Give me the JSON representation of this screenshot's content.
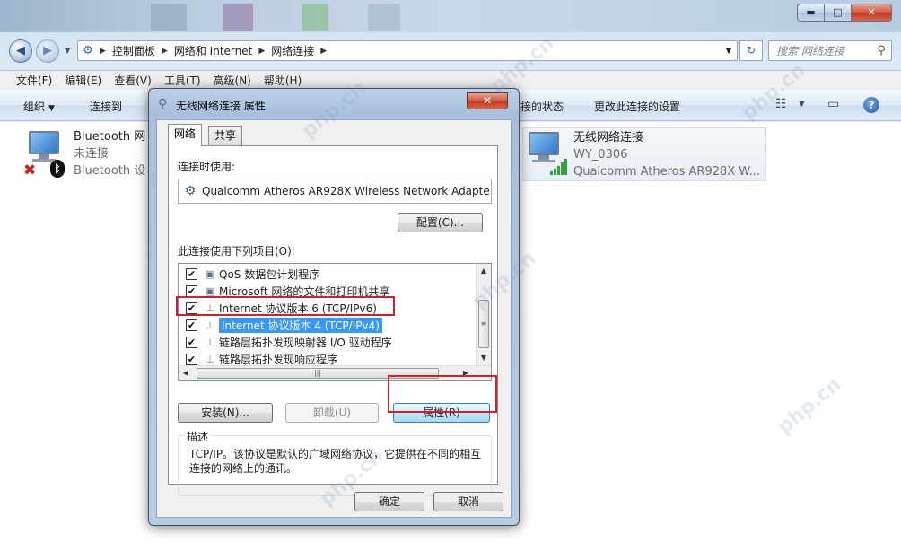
{
  "explorer": {
    "window_controls": {
      "minimize": "▬",
      "maximize": "□",
      "close": "✕"
    },
    "breadcrumb": [
      "控制面板",
      "网络和 Internet",
      "网络连接"
    ],
    "search_placeholder": "搜索 网络连接",
    "menu": [
      "文件(F)",
      "编辑(E)",
      "查看(V)",
      "工具(T)",
      "高级(N)",
      "帮助(H)"
    ],
    "commands": {
      "organize": "组织",
      "connect_to": "连接到",
      "view_status": "接的状态",
      "change_settings": "更改此连接的设置"
    },
    "connections": [
      {
        "name": "Bluetooth 网",
        "status": "未连接",
        "device": "Bluetooth 设"
      },
      {
        "name": "无线网络连接",
        "status": "WY_0306",
        "device": "Qualcomm Atheros AR928X W..."
      }
    ]
  },
  "dialog": {
    "title": "无线网络连接 属性",
    "tabs": [
      "网络",
      "共享"
    ],
    "connect_using_label": "连接时使用:",
    "adapter": "Qualcomm Atheros AR928X Wireless Network Adapte",
    "configure_button": "配置(C)...",
    "items_label": "此连接使用下列项目(O):",
    "items": [
      {
        "label": "QoS 数据包计划程序",
        "checked": true
      },
      {
        "label": "Microsoft 网络的文件和打印机共享",
        "checked": true
      },
      {
        "label": "Internet 协议版本 6 (TCP/IPv6)",
        "checked": true
      },
      {
        "label": "Internet 协议版本 4 (TCP/IPv4)",
        "checked": true,
        "selected": true
      },
      {
        "label": "链路层拓扑发现映射器 I/O 驱动程序",
        "checked": true
      },
      {
        "label": "链路层拓扑发现响应程序",
        "checked": true
      }
    ],
    "install_button": "安装(N)...",
    "uninstall_button": "卸载(U)",
    "properties_button": "属性(R)",
    "description_title": "描述",
    "description": "TCP/IP。该协议是默认的广域网络协议，它提供在不同的相互连接的网络上的通讯。",
    "ok_button": "确定",
    "cancel_button": "取消"
  },
  "colors": {
    "highlight": "#d0202a",
    "selection": "#3399ff"
  }
}
